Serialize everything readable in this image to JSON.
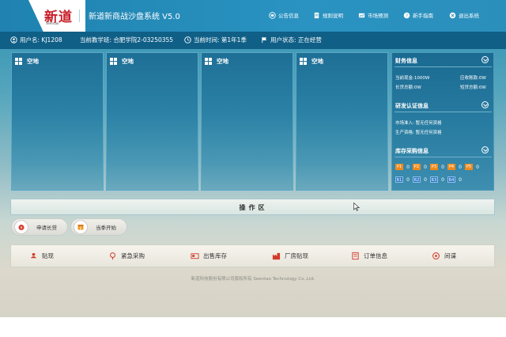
{
  "header": {
    "logo_text": "新道",
    "logo_sub": "Seentao",
    "app_title": "新道新商战沙盘系统 V5.0",
    "nav": [
      {
        "label": "公告信息",
        "icon": "announcement-icon"
      },
      {
        "label": "规则说明",
        "icon": "document-icon"
      },
      {
        "label": "市场预测",
        "icon": "chart-icon"
      },
      {
        "label": "新手指南",
        "icon": "guide-icon"
      },
      {
        "label": "退出系统",
        "icon": "exit-icon"
      }
    ]
  },
  "status": {
    "user": "用户名: KJ1208",
    "class": "当前教学班: 合肥学院2-03250355",
    "time": "当前时间: 第1年1季",
    "state": "用户状态: 正在经营"
  },
  "plants": [
    {
      "label": "空地"
    },
    {
      "label": "空地"
    },
    {
      "label": "空地"
    },
    {
      "label": "空地"
    }
  ],
  "info": {
    "finance": {
      "title": "财务信息",
      "cash": "当前现金:1000W",
      "receivable": "应收账款:0W",
      "long_loan": "长贷总额:0W",
      "short_loan": "短贷总额:0W"
    },
    "rd": {
      "title": "研发认证信息",
      "market": "市场准入: 暂无任何资格",
      "production": "生产资格: 暂无任何资格"
    },
    "inventory": {
      "title": "库存采购信息",
      "products": [
        {
          "name": "P1",
          "count": "0"
        },
        {
          "name": "P2",
          "count": "0"
        },
        {
          "name": "P3",
          "count": "0"
        },
        {
          "name": "P4",
          "count": "0"
        },
        {
          "name": "P5",
          "count": "0"
        }
      ],
      "raws": [
        {
          "name": "R1",
          "count": "0"
        },
        {
          "name": "R2",
          "count": "0"
        },
        {
          "name": "R3",
          "count": "0"
        },
        {
          "name": "R4",
          "count": "0"
        }
      ]
    }
  },
  "operation": {
    "label": "操作区",
    "actions": [
      {
        "label": "申请长贷",
        "icon": "loan-icon"
      },
      {
        "label": "当季开始",
        "icon": "calendar-icon"
      }
    ]
  },
  "toolbar": [
    {
      "label": "贴现",
      "icon": "discount-icon"
    },
    {
      "label": "紧急采购",
      "icon": "urgent-purchase-icon"
    },
    {
      "label": "出售库存",
      "icon": "sell-inventory-icon"
    },
    {
      "label": "厂房贴现",
      "icon": "factory-discount-icon"
    },
    {
      "label": "订单信息",
      "icon": "order-icon"
    },
    {
      "label": "间谍",
      "icon": "spy-icon"
    }
  ],
  "footer": "新道科技股份有限公司版权所有 Seentao Technology Co.,Ltd.",
  "colors": {
    "header": "#2a93c1",
    "status_bar": "#0f5f87",
    "product_badge": "#f08a1c",
    "raw_badge": "#2b7ac2"
  }
}
